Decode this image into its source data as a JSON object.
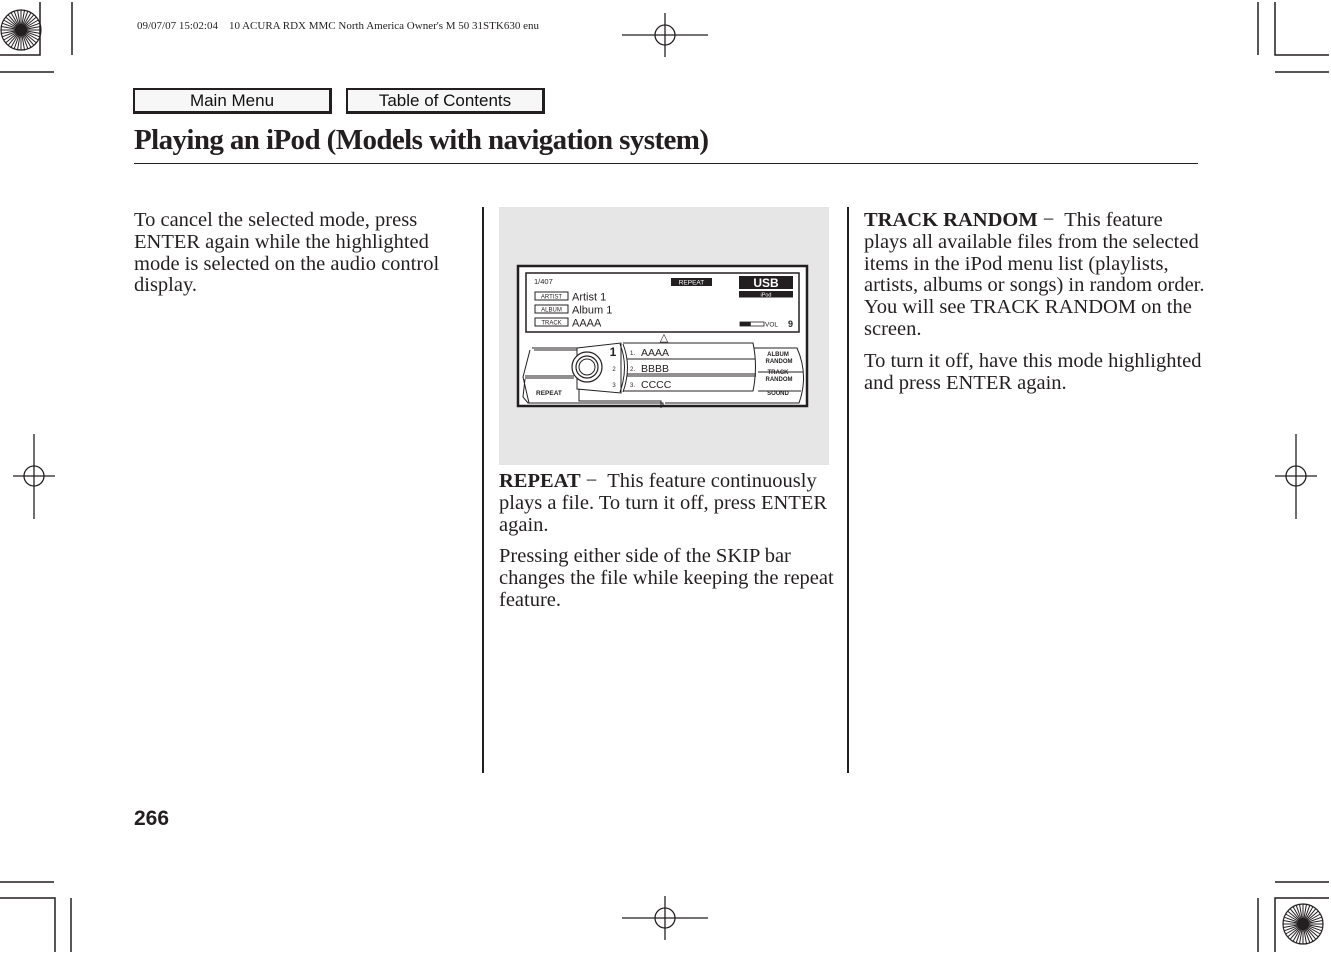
{
  "print_header": "09/07/07 15:02:04    10 ACURA RDX MMC North America Owner's M 50 31STK630 enu",
  "nav": {
    "main_menu": "Main Menu",
    "table_of_contents": "Table of Contents"
  },
  "page_title": "Playing an iPod (Models with navigation system)",
  "column1": {
    "paragraph": "To cancel the selected mode, press ENTER again while the highlighted mode is selected on the audio control display."
  },
  "figure": {
    "track_counter": "1/407",
    "mode_indicator": "REPEAT",
    "source": "USB",
    "source_sub": "iPod",
    "labels": {
      "artist": "ARTIST",
      "album": "ALBUM",
      "track": "TRACK"
    },
    "values": {
      "artist": "Artist 1",
      "album": "Album 1",
      "track": "AAAA"
    },
    "volume_label": "VOL",
    "volume_value": "9",
    "volume_level_fraction": 0.45,
    "up_arrow": "△",
    "knob_numbers": [
      "1",
      "2",
      "3"
    ],
    "list_items": [
      {
        "num": "1.",
        "text": "AAAA"
      },
      {
        "num": "2.",
        "text": "BBBB"
      },
      {
        "num": "3.",
        "text": "CCCC"
      }
    ],
    "left_button": "REPEAT",
    "right_buttons": {
      "album_random_1": "ALBUM",
      "album_random_2": "RANDOM",
      "track_random_1": "TRACK",
      "track_random_2": "RANDOM",
      "sound": "SOUND"
    }
  },
  "column2": {
    "repeat_term": "REPEAT",
    "repeat_dash": " −  ",
    "repeat_desc": "This feature continuously plays a file. To turn it off, press ENTER again.",
    "skip_paragraph": "Pressing either side of the SKIP bar changes the file while keeping the repeat feature."
  },
  "column3": {
    "term": "TRACK RANDOM",
    "dash": " −  ",
    "desc": "This feature plays all available files from the selected items in the iPod menu list (playlists, artists, albums or songs) in random order. You will see TRACK RANDOM on the screen.",
    "turn_off": "To turn it off, have this mode highlighted and press ENTER again."
  },
  "page_number": "266"
}
